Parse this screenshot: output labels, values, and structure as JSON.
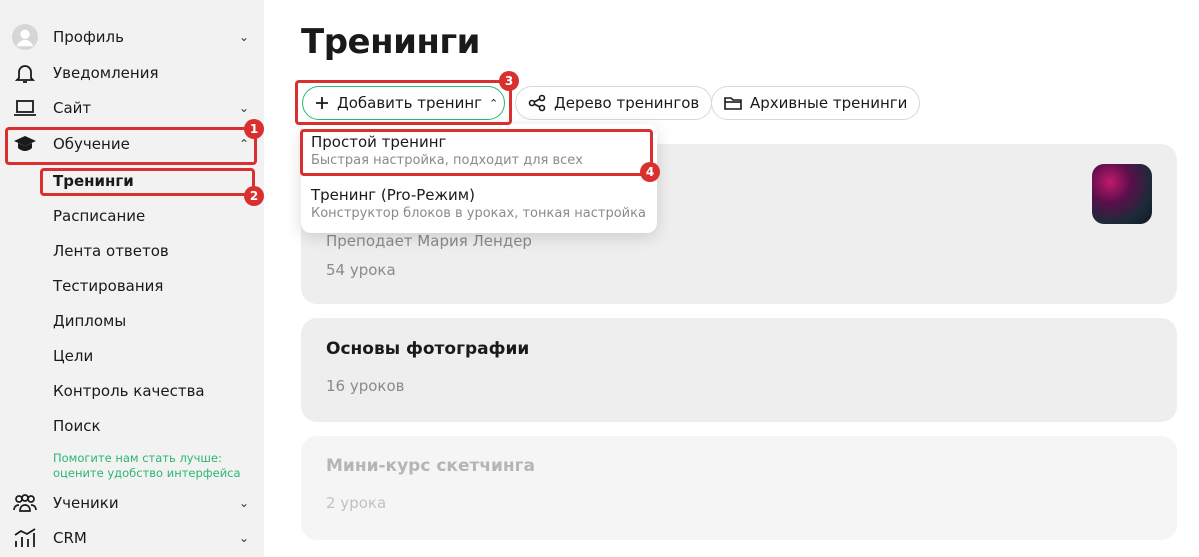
{
  "sidebar": {
    "items": [
      {
        "label": "Профиль",
        "icon": "profile-avatar-icon"
      },
      {
        "label": "Уведомления",
        "icon": "bell-icon"
      },
      {
        "label": "Сайт",
        "icon": "laptop-icon"
      },
      {
        "label": "Обучение",
        "icon": "graduation-cap-icon"
      }
    ],
    "subitems": [
      "Тренинги",
      "Расписание",
      "Лента ответов",
      "Тестирования",
      "Дипломы",
      "Цели",
      "Контроль качества",
      "Поиск"
    ],
    "help_line1": "Помогите нам стать лучше:",
    "help_line2": "оцените удобство интерфейса",
    "bottom_items": [
      {
        "label": "Ученики",
        "icon": "users-icon"
      },
      {
        "label": "CRM",
        "icon": "chart-icon"
      }
    ]
  },
  "main": {
    "title": "Тренинги",
    "buttons": {
      "add": "Добавить тренинг",
      "tree": "Дерево тренингов",
      "archive": "Архивные тренинги"
    },
    "dropdown": [
      {
        "title": "Простой тренинг",
        "subtitle": "Быстрая настройка, подходит для всех"
      },
      {
        "title": "Тренинг (Pro-Режим)",
        "subtitle": "Конструктор блоков в уроках, тонкая настройка"
      }
    ],
    "cards": [
      {
        "teacher": "Преподает Мария Лендер",
        "lessons": "54 урока"
      },
      {
        "title": "Основы фотографии",
        "lessons": "16 уроков"
      },
      {
        "title": "Мини-курс скетчинга",
        "lessons": "2 урока"
      }
    ]
  },
  "annotations": [
    "1",
    "2",
    "3",
    "4"
  ],
  "colors": {
    "accent": "#2bb673",
    "highlight": "#d9302f",
    "sidebar_bg": "#f2f2f2"
  }
}
